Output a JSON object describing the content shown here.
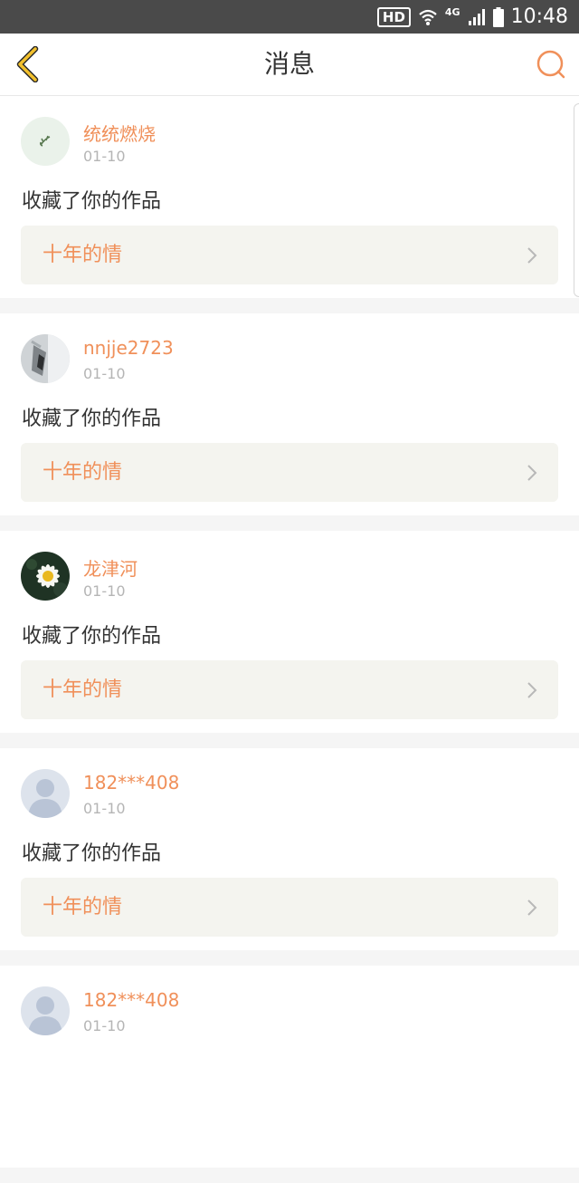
{
  "status_bar": {
    "hd": "HD",
    "network": "4G",
    "time": "10:48"
  },
  "header": {
    "title": "消息",
    "back_icon": "chevron-left-icon",
    "search_icon": "search-icon",
    "accent_color": "#f0905a"
  },
  "messages": [
    {
      "username": "统统燃烧",
      "date": "01-10",
      "action": "收藏了你的作品",
      "work_title": "十年的情",
      "avatar": "plant-sprout-avatar"
    },
    {
      "username": "nnjje2723",
      "date": "01-10",
      "action": "收藏了你的作品",
      "work_title": "十年的情",
      "avatar": "photo-avatar"
    },
    {
      "username": "龙津河",
      "date": "01-10",
      "action": "收藏了你的作品",
      "work_title": "十年的情",
      "avatar": "daisy-flower-avatar"
    },
    {
      "username": "182***408",
      "date": "01-10",
      "action": "收藏了你的作品",
      "work_title": "十年的情",
      "avatar": "default-person-avatar"
    },
    {
      "username": "182***408",
      "date": "01-10",
      "avatar": "default-person-avatar"
    }
  ]
}
